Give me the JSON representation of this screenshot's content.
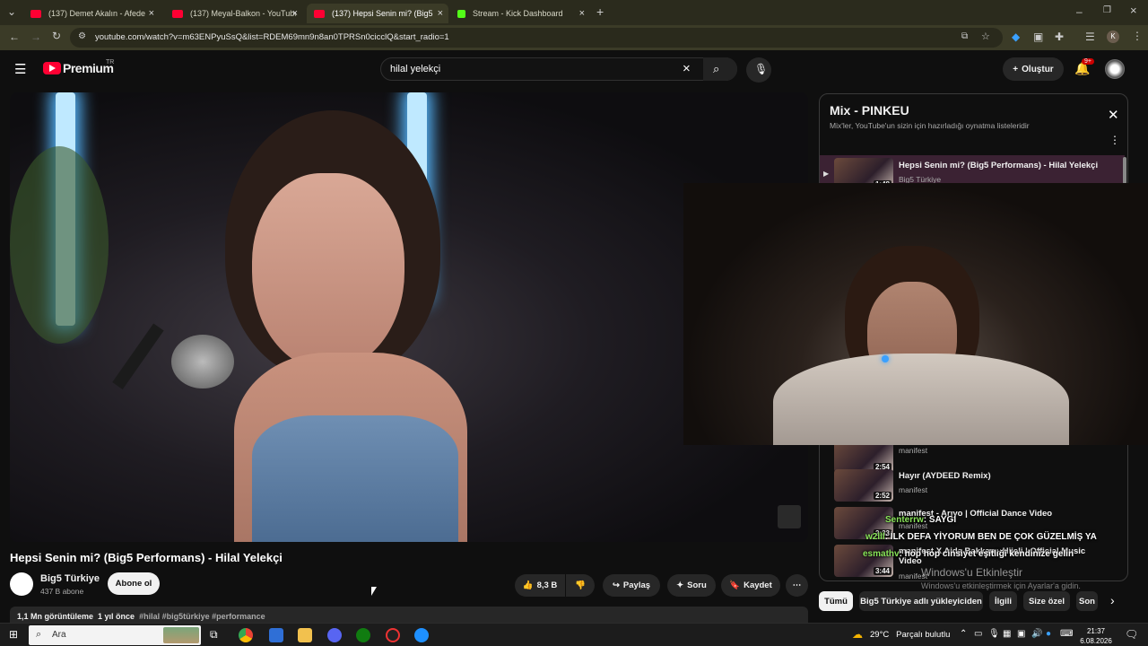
{
  "browser": {
    "tabs": [
      {
        "title": "(137) Demet Akalın - Afede",
        "active": false
      },
      {
        "title": "(137) Meyal-Balkon - YouTube",
        "active": false
      },
      {
        "title": "(137) Hepsi Senin mi? (Big5",
        "active": true
      },
      {
        "title": "Stream - Kick Dashboard",
        "active": false
      }
    ],
    "url": "youtube.com/watch?v=m63ENPyuSsQ&list=RDEM69mn9n8an0TPRSn0cicclQ&start_radio=1",
    "profile_initial": "K"
  },
  "youtube": {
    "logo_text": "Premium",
    "logo_badge": "TR",
    "search_value": "hilal yelekçi",
    "create_label": "Oluştur",
    "notif_count": "9+"
  },
  "video": {
    "title": "Hepsi Senin mi? (Big5 Performans) - Hilal Yelekçi",
    "channel": "Big5 Türkiye",
    "subscribers": "437 B abone",
    "subscribe_label": "Abone ol",
    "likes": "8,3 B",
    "share_label": "Paylaş",
    "ask_label": "Soru",
    "save_label": "Kaydet",
    "views": "1,1 Mn görüntüleme",
    "age": "1 yıl önce",
    "tags": "#hilal #big5türkiye #performance"
  },
  "mix": {
    "title": "Mix - PINKEU",
    "subtitle": "Mix'ler, YouTube'un sizin için hazırladığı oynatma listeleridir",
    "items": [
      {
        "title": "Hepsi Senin mi? (Big5 Performans) - Hilal Yelekçi",
        "channel": "Big5 Türkiye",
        "duration": "1:48"
      },
      {
        "title": "",
        "channel": "manifest",
        "duration": "2:54"
      },
      {
        "title": "Hayır (AYDEED Remix)",
        "channel": "manifest",
        "duration": "2:52"
      },
      {
        "title": "manifest - Arıyo | Official Dance Video",
        "channel": "manifest",
        "duration": "2:33"
      },
      {
        "title": "manifest X Aida Bakkan - Hijeli | Official Music Video",
        "channel": "manifest",
        "duration": "3:44"
      }
    ]
  },
  "chat": [
    {
      "user": "Senterrw",
      "text": ": SAYGI"
    },
    {
      "user": "w2lll",
      "text": ": İLK DEFA YİYORUM BEN DE ÇOK GÜZELMİŞ YA"
    },
    {
      "user": "esmathv",
      "text": ": hop hop cinsiyet eşitliği kendinize gelin"
    }
  ],
  "windows_activation": {
    "title": "Windows'u Etkinleştir",
    "text": "Windows'u etkinleştirmek için Ayarlar'a gidin."
  },
  "chips": [
    "Tümü",
    "Big5 Türkiye adlı yükleyiciden",
    "İlgili",
    "Size özel",
    "Son"
  ],
  "taskbar": {
    "search_placeholder": "Ara",
    "temperature": "29°C",
    "weather": "Parçalı bulutlu",
    "time": "21:37",
    "date": "6.08.2026"
  }
}
